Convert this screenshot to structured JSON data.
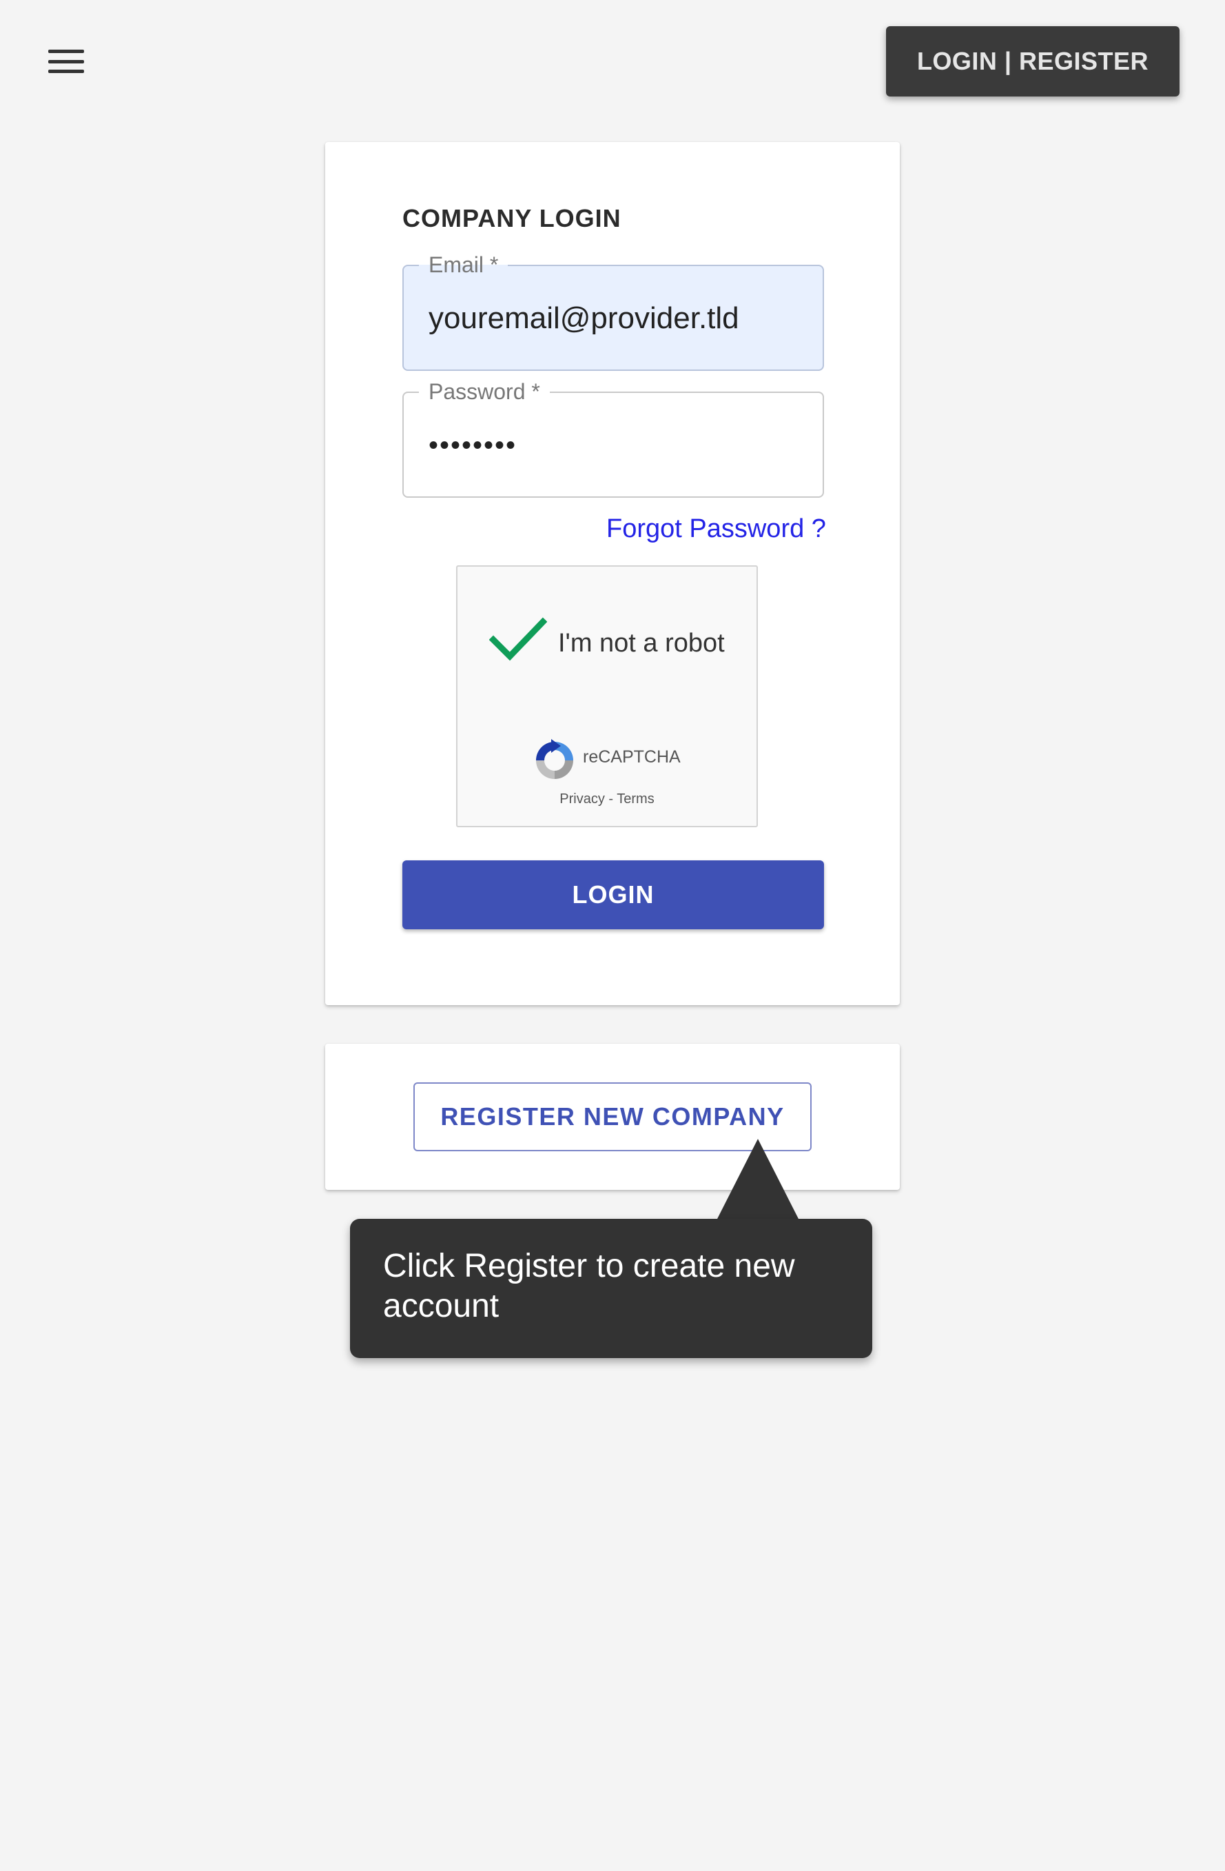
{
  "header": {
    "menu_icon": "hamburger-menu-icon",
    "auth_button_label": "LOGIN | REGISTER"
  },
  "login_card": {
    "title": "COMPANY LOGIN",
    "email": {
      "label": "Email *",
      "value": "youremail@provider.tld"
    },
    "password": {
      "label": "Password *",
      "value": "••••••••"
    },
    "forgot_password_label": "Forgot Password ?",
    "recaptcha": {
      "checkbox_label": "I'm not a robot",
      "checked": true,
      "brand": "reCAPTCHA",
      "privacy_label": "Privacy",
      "separator": " - ",
      "terms_label": "Terms"
    },
    "login_button_label": "LOGIN"
  },
  "register_card": {
    "register_button_label": "REGISTER NEW COMPANY"
  },
  "tooltip": {
    "text": "Click Register to create new account"
  },
  "colors": {
    "primary": "#3f51b5",
    "page_background": "#f4f4f4",
    "tooltip_background": "#333333",
    "link": "#2323e6",
    "check_green": "#0f9d58"
  }
}
